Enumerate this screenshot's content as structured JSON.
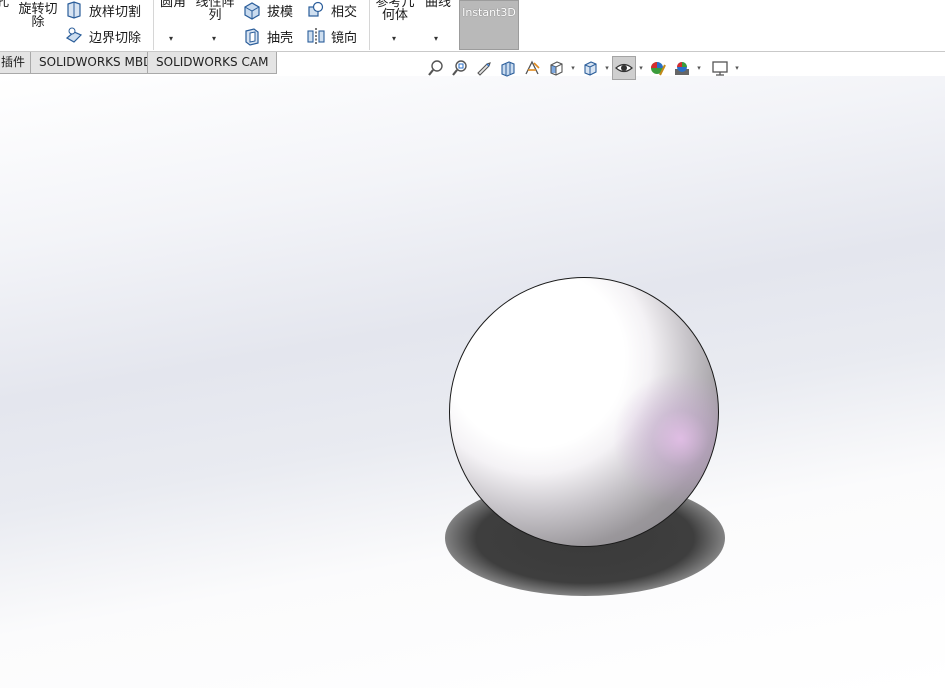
{
  "ribbon": {
    "partial_left_label": "孔",
    "revolve_cut_label_line1": "旋转切",
    "revolve_cut_label_line2": "除",
    "lofted_cut_label": "放样切割",
    "boundary_cut_label": "边界切除",
    "fillet_label": "圆角",
    "linear_pattern_line1": "线性阵",
    "linear_pattern_line2": "列",
    "draft_label": "拔模",
    "intersect_label": "相交",
    "shell_label": "抽壳",
    "mirror_label": "镜向",
    "ref_geometry_line1": "参考几",
    "ref_geometry_line2": "何体",
    "curves_label": "曲线",
    "instant3d_label": "Instant3D"
  },
  "tabs": [
    {
      "label": "插件"
    },
    {
      "label": "SOLIDWORKS MBD"
    },
    {
      "label": "SOLIDWORKS CAM"
    }
  ],
  "hud": {
    "icons": [
      "zoom-to-fit-icon",
      "zoom-to-area-icon",
      "previous-view-icon",
      "section-view-icon",
      "dynamic-annotation-icon",
      "view-orientation-icon",
      "display-style-icon",
      "hide-show-items-icon",
      "edit-appearance-icon",
      "apply-scene-icon",
      "view-settings-icon"
    ]
  },
  "colors": {
    "instant3d_active": "#b9b9b9",
    "tab_bg": "#e4e4e4",
    "shadow": "#3a3a3a"
  }
}
